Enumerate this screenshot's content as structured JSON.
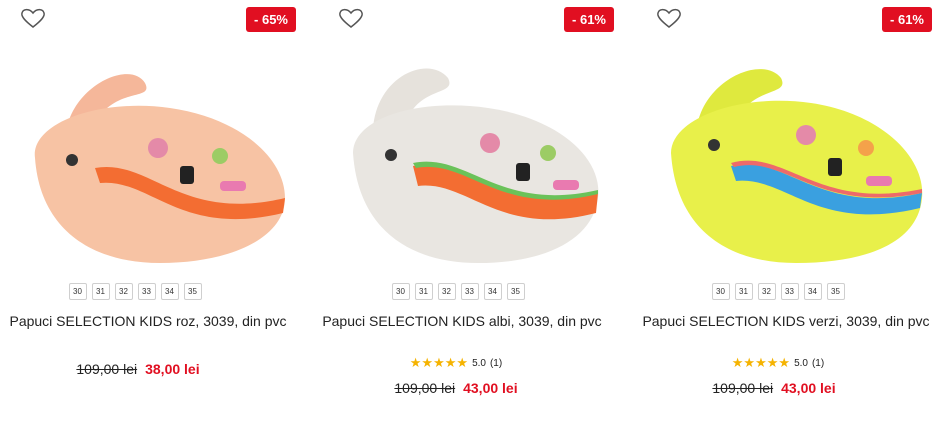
{
  "products": [
    {
      "badge": "- 65%",
      "sizes": [
        "30",
        "31",
        "32",
        "33",
        "34",
        "35"
      ],
      "name": "Papuci SELECTION KIDS roz, 3039, din pvc",
      "old_price": "109,00 lei",
      "new_price": "38,00 lei",
      "colors": {
        "body": "#f7c3a4",
        "strap": "#f5b79a",
        "stripe": "#f36d32",
        "band": "#f36d32"
      }
    },
    {
      "badge": "- 61%",
      "sizes": [
        "30",
        "31",
        "32",
        "33",
        "34",
        "35"
      ],
      "name": "Papuci SELECTION KIDS albi, 3039, din pvc",
      "rating_value": "5.0",
      "rating_count": "(1)",
      "old_price": "109,00 lei",
      "new_price": "43,00 lei",
      "colors": {
        "body": "#e9e6e1",
        "strap": "#e6e2dc",
        "stripe": "#f36d32",
        "band": "#6ac259"
      }
    },
    {
      "badge": "- 61%",
      "sizes": [
        "30",
        "31",
        "32",
        "33",
        "34",
        "35"
      ],
      "name": "Papuci SELECTION KIDS verzi, 3039, din pvc",
      "rating_value": "5.0",
      "rating_count": "(1)",
      "old_price": "109,00 lei",
      "new_price": "43,00 lei",
      "colors": {
        "body": "#e8f04a",
        "strap": "#dfe93e",
        "stripe": "#3aa0e0",
        "band": "#ee6a6a"
      }
    }
  ],
  "accent_color": "#e10f21",
  "star_color": "#f5b301",
  "icons": {
    "favorite": "heart-outline-icon",
    "rating": "star-icon"
  }
}
